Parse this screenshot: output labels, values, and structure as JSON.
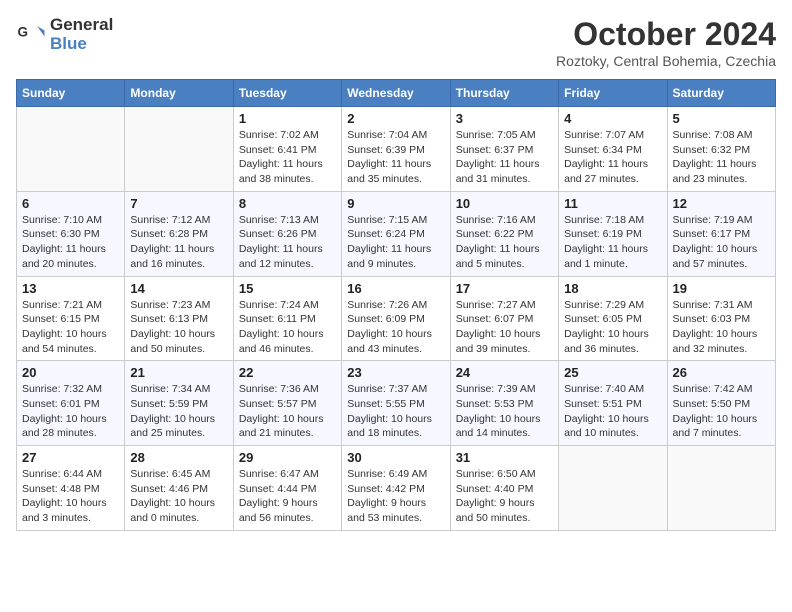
{
  "header": {
    "logo_line1": "General",
    "logo_line2": "Blue",
    "month_title": "October 2024",
    "location": "Roztoky, Central Bohemia, Czechia"
  },
  "weekdays": [
    "Sunday",
    "Monday",
    "Tuesday",
    "Wednesday",
    "Thursday",
    "Friday",
    "Saturday"
  ],
  "weeks": [
    [
      {
        "day": "",
        "empty": true
      },
      {
        "day": "",
        "empty": true
      },
      {
        "day": "1",
        "sunrise": "Sunrise: 7:02 AM",
        "sunset": "Sunset: 6:41 PM",
        "daylight": "Daylight: 11 hours and 38 minutes."
      },
      {
        "day": "2",
        "sunrise": "Sunrise: 7:04 AM",
        "sunset": "Sunset: 6:39 PM",
        "daylight": "Daylight: 11 hours and 35 minutes."
      },
      {
        "day": "3",
        "sunrise": "Sunrise: 7:05 AM",
        "sunset": "Sunset: 6:37 PM",
        "daylight": "Daylight: 11 hours and 31 minutes."
      },
      {
        "day": "4",
        "sunrise": "Sunrise: 7:07 AM",
        "sunset": "Sunset: 6:34 PM",
        "daylight": "Daylight: 11 hours and 27 minutes."
      },
      {
        "day": "5",
        "sunrise": "Sunrise: 7:08 AM",
        "sunset": "Sunset: 6:32 PM",
        "daylight": "Daylight: 11 hours and 23 minutes."
      }
    ],
    [
      {
        "day": "6",
        "sunrise": "Sunrise: 7:10 AM",
        "sunset": "Sunset: 6:30 PM",
        "daylight": "Daylight: 11 hours and 20 minutes."
      },
      {
        "day": "7",
        "sunrise": "Sunrise: 7:12 AM",
        "sunset": "Sunset: 6:28 PM",
        "daylight": "Daylight: 11 hours and 16 minutes."
      },
      {
        "day": "8",
        "sunrise": "Sunrise: 7:13 AM",
        "sunset": "Sunset: 6:26 PM",
        "daylight": "Daylight: 11 hours and 12 minutes."
      },
      {
        "day": "9",
        "sunrise": "Sunrise: 7:15 AM",
        "sunset": "Sunset: 6:24 PM",
        "daylight": "Daylight: 11 hours and 9 minutes."
      },
      {
        "day": "10",
        "sunrise": "Sunrise: 7:16 AM",
        "sunset": "Sunset: 6:22 PM",
        "daylight": "Daylight: 11 hours and 5 minutes."
      },
      {
        "day": "11",
        "sunrise": "Sunrise: 7:18 AM",
        "sunset": "Sunset: 6:19 PM",
        "daylight": "Daylight: 11 hours and 1 minute."
      },
      {
        "day": "12",
        "sunrise": "Sunrise: 7:19 AM",
        "sunset": "Sunset: 6:17 PM",
        "daylight": "Daylight: 10 hours and 57 minutes."
      }
    ],
    [
      {
        "day": "13",
        "sunrise": "Sunrise: 7:21 AM",
        "sunset": "Sunset: 6:15 PM",
        "daylight": "Daylight: 10 hours and 54 minutes."
      },
      {
        "day": "14",
        "sunrise": "Sunrise: 7:23 AM",
        "sunset": "Sunset: 6:13 PM",
        "daylight": "Daylight: 10 hours and 50 minutes."
      },
      {
        "day": "15",
        "sunrise": "Sunrise: 7:24 AM",
        "sunset": "Sunset: 6:11 PM",
        "daylight": "Daylight: 10 hours and 46 minutes."
      },
      {
        "day": "16",
        "sunrise": "Sunrise: 7:26 AM",
        "sunset": "Sunset: 6:09 PM",
        "daylight": "Daylight: 10 hours and 43 minutes."
      },
      {
        "day": "17",
        "sunrise": "Sunrise: 7:27 AM",
        "sunset": "Sunset: 6:07 PM",
        "daylight": "Daylight: 10 hours and 39 minutes."
      },
      {
        "day": "18",
        "sunrise": "Sunrise: 7:29 AM",
        "sunset": "Sunset: 6:05 PM",
        "daylight": "Daylight: 10 hours and 36 minutes."
      },
      {
        "day": "19",
        "sunrise": "Sunrise: 7:31 AM",
        "sunset": "Sunset: 6:03 PM",
        "daylight": "Daylight: 10 hours and 32 minutes."
      }
    ],
    [
      {
        "day": "20",
        "sunrise": "Sunrise: 7:32 AM",
        "sunset": "Sunset: 6:01 PM",
        "daylight": "Daylight: 10 hours and 28 minutes."
      },
      {
        "day": "21",
        "sunrise": "Sunrise: 7:34 AM",
        "sunset": "Sunset: 5:59 PM",
        "daylight": "Daylight: 10 hours and 25 minutes."
      },
      {
        "day": "22",
        "sunrise": "Sunrise: 7:36 AM",
        "sunset": "Sunset: 5:57 PM",
        "daylight": "Daylight: 10 hours and 21 minutes."
      },
      {
        "day": "23",
        "sunrise": "Sunrise: 7:37 AM",
        "sunset": "Sunset: 5:55 PM",
        "daylight": "Daylight: 10 hours and 18 minutes."
      },
      {
        "day": "24",
        "sunrise": "Sunrise: 7:39 AM",
        "sunset": "Sunset: 5:53 PM",
        "daylight": "Daylight: 10 hours and 14 minutes."
      },
      {
        "day": "25",
        "sunrise": "Sunrise: 7:40 AM",
        "sunset": "Sunset: 5:51 PM",
        "daylight": "Daylight: 10 hours and 10 minutes."
      },
      {
        "day": "26",
        "sunrise": "Sunrise: 7:42 AM",
        "sunset": "Sunset: 5:50 PM",
        "daylight": "Daylight: 10 hours and 7 minutes."
      }
    ],
    [
      {
        "day": "27",
        "sunrise": "Sunrise: 6:44 AM",
        "sunset": "Sunset: 4:48 PM",
        "daylight": "Daylight: 10 hours and 3 minutes."
      },
      {
        "day": "28",
        "sunrise": "Sunrise: 6:45 AM",
        "sunset": "Sunset: 4:46 PM",
        "daylight": "Daylight: 10 hours and 0 minutes."
      },
      {
        "day": "29",
        "sunrise": "Sunrise: 6:47 AM",
        "sunset": "Sunset: 4:44 PM",
        "daylight": "Daylight: 9 hours and 56 minutes."
      },
      {
        "day": "30",
        "sunrise": "Sunrise: 6:49 AM",
        "sunset": "Sunset: 4:42 PM",
        "daylight": "Daylight: 9 hours and 53 minutes."
      },
      {
        "day": "31",
        "sunrise": "Sunrise: 6:50 AM",
        "sunset": "Sunset: 4:40 PM",
        "daylight": "Daylight: 9 hours and 50 minutes."
      },
      {
        "day": "",
        "empty": true
      },
      {
        "day": "",
        "empty": true
      }
    ]
  ]
}
